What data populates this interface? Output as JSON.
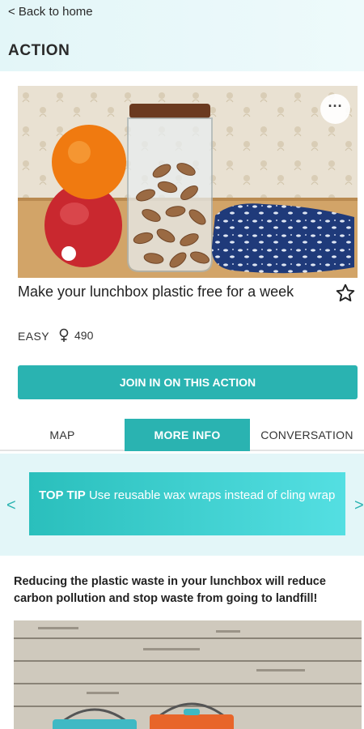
{
  "nav": {
    "back_label": "< Back to home"
  },
  "page": {
    "title": "ACTION"
  },
  "action": {
    "title": "Make your lunchbox plastic free for a week",
    "difficulty": "EASY",
    "participants": "490",
    "join_label": "JOIN IN ON THIS ACTION",
    "more_label": "···"
  },
  "tabs": [
    {
      "label": "MAP"
    },
    {
      "label": "MORE INFO"
    },
    {
      "label": "CONVERSATION"
    }
  ],
  "tip": {
    "heading": "TOP TIP",
    "text": "Use reusable wax wraps instead of cling wrap",
    "prev": "<",
    "next": ">"
  },
  "description": "Reducing the plastic waste in your lunchbox will reduce carbon pollution and stop waste from going to landfill!",
  "colors": {
    "accent": "#2ab3b1",
    "header_bg": "#e3f6f8"
  },
  "icons": {
    "star": "star-icon",
    "participants": "person-icon",
    "more": "more-dots-icon"
  }
}
